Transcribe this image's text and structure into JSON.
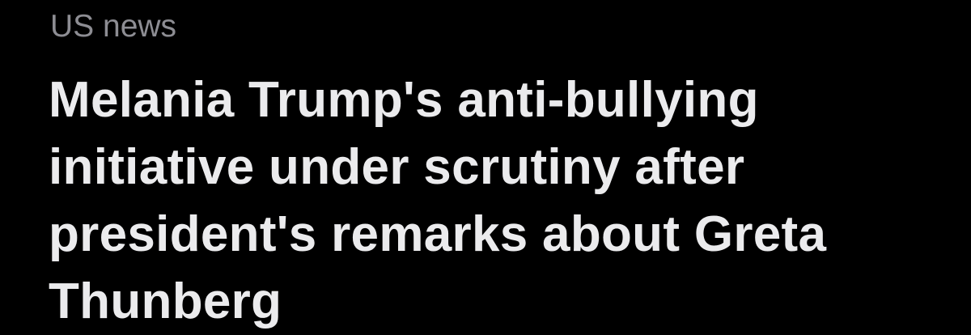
{
  "article": {
    "section": "US news",
    "headline_lines": [
      "Melania Trump's anti-bullying",
      "initiative under scrutiny after",
      "president's remarks about Greta",
      "Thunberg"
    ]
  },
  "colors": {
    "background": "#000000",
    "section_label": "#8d8d93",
    "headline": "#ebebed"
  }
}
